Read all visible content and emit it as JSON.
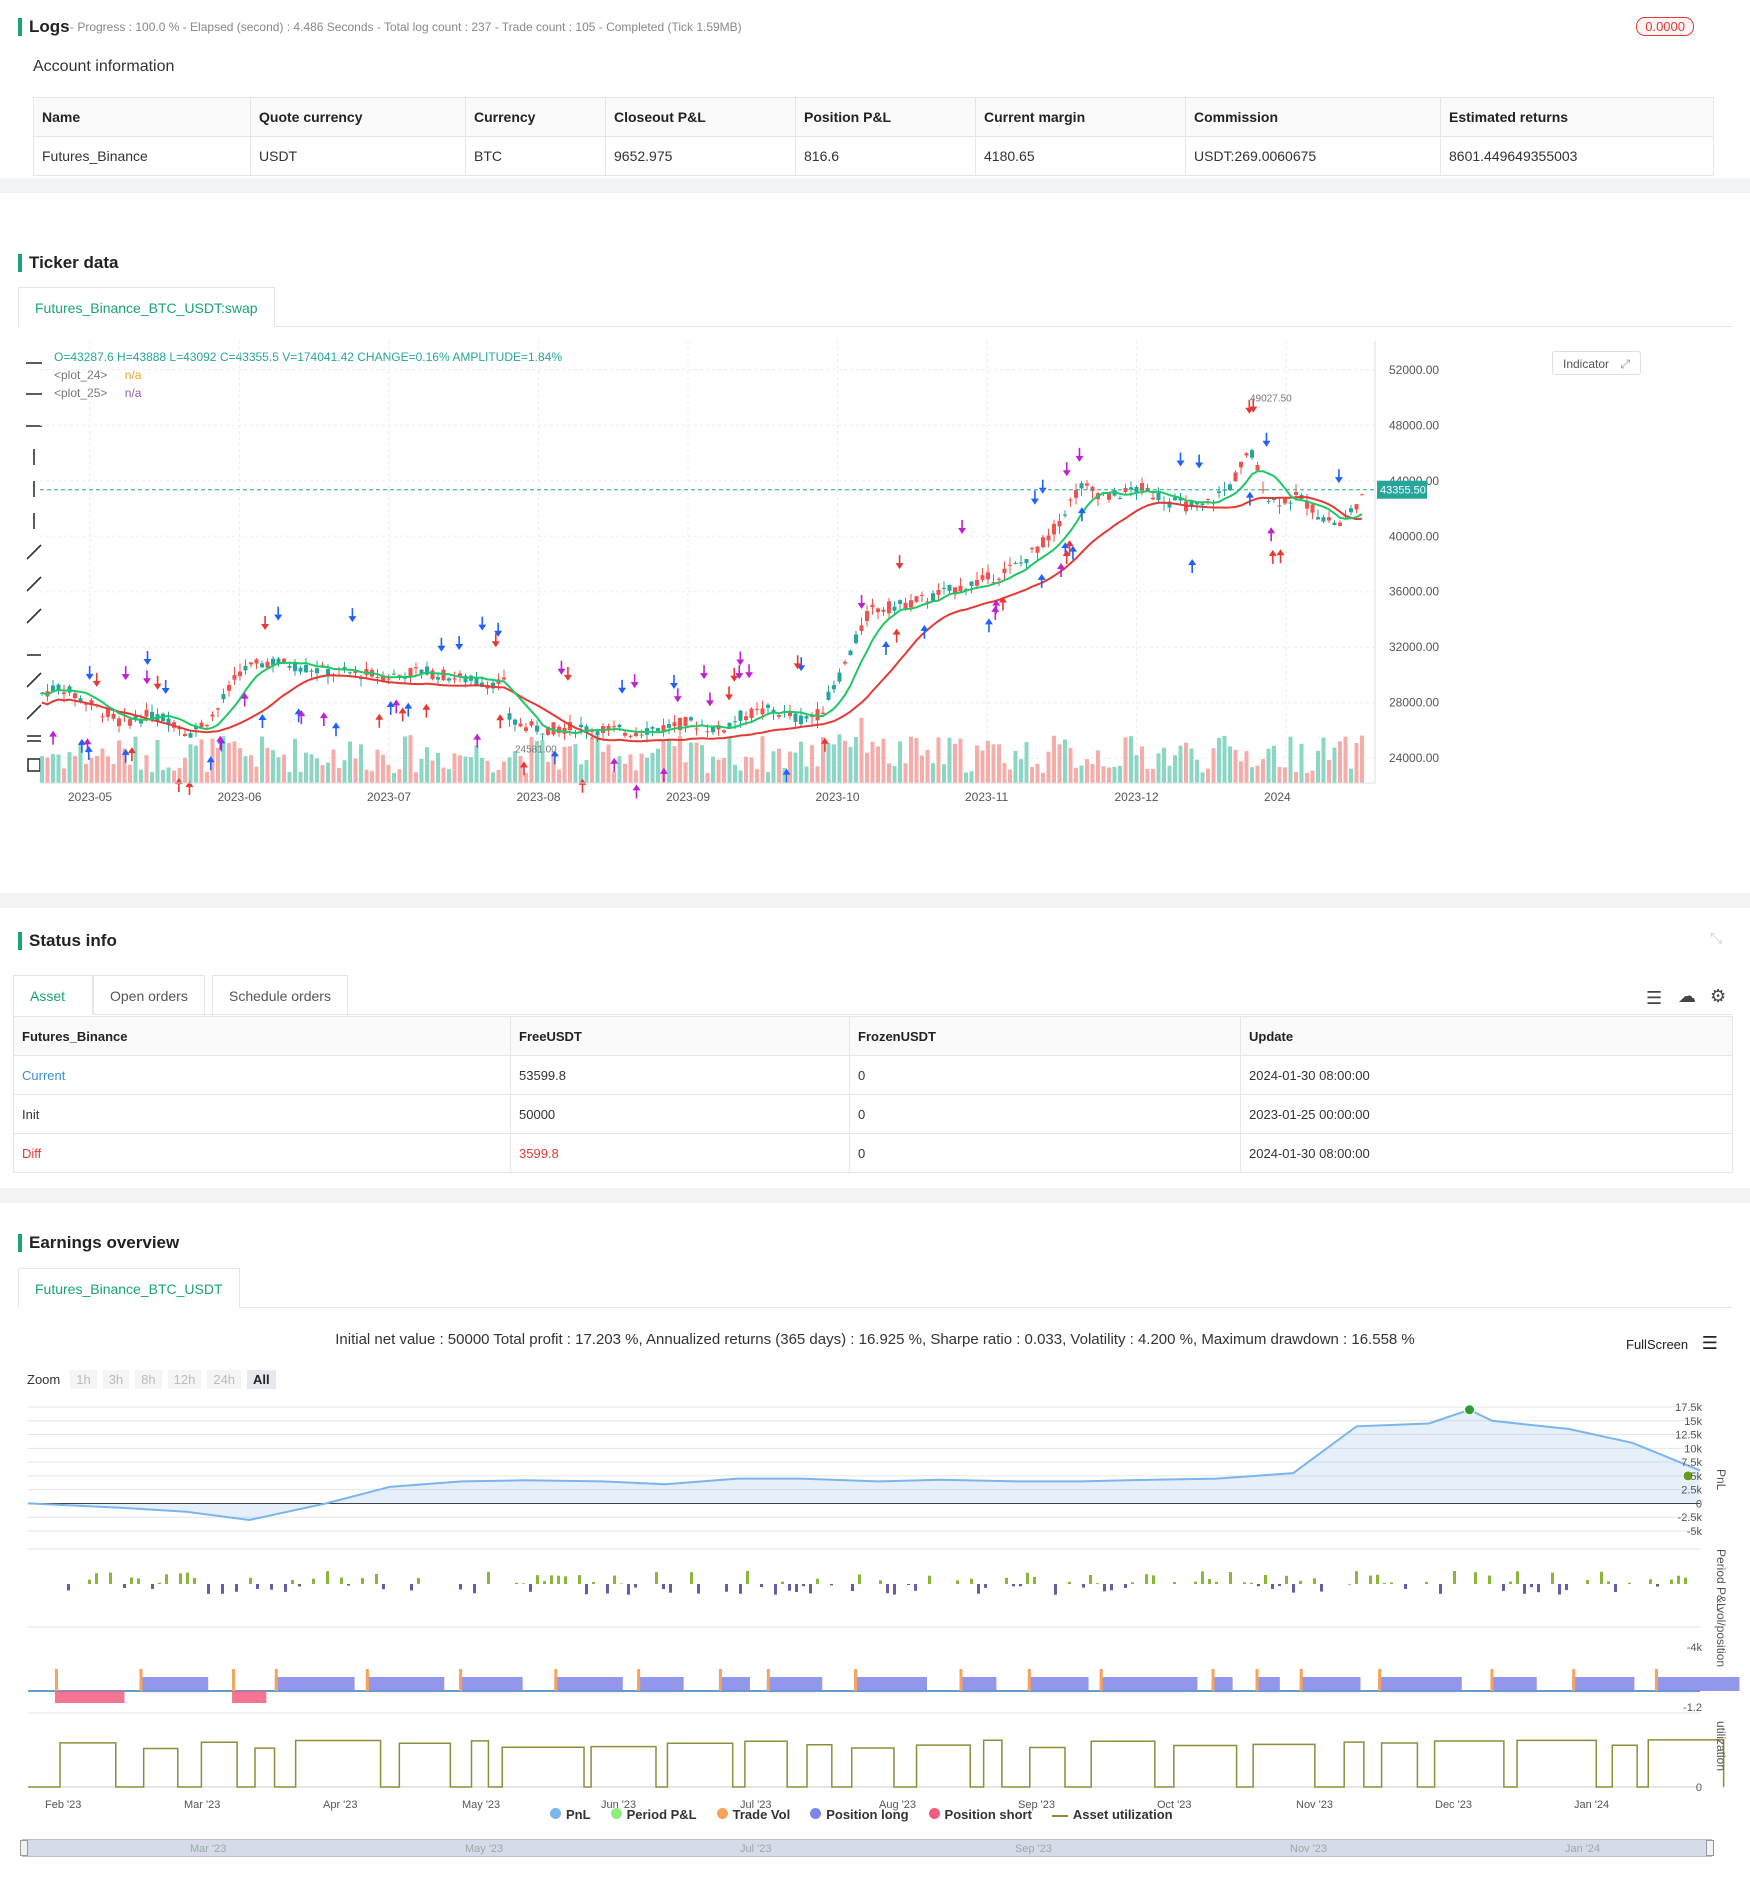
{
  "logs": {
    "title": "Logs",
    "status": "- Progress : 100.0 % - Elapsed (second) : 4.486  Seconds - Total log count : 237 - Trade count : 105 - Completed (Tick 1.59MB)",
    "badge": "0.0000",
    "account_title": "Account information",
    "columns": [
      "Name",
      "Quote currency",
      "Currency",
      "Closeout P&L",
      "Position P&L",
      "Current margin",
      "Commission",
      "Estimated returns"
    ],
    "row": [
      "Futures_Binance",
      "USDT",
      "BTC",
      "9652.975",
      "816.6",
      "4180.65",
      "USDT:269.0060675",
      "8601.449649355003"
    ]
  },
  "ticker": {
    "title": "Ticker data",
    "tab": "Futures_Binance_BTC_USDT:swap",
    "ohlc_line": "O=43287.6 H=43888 L=43092 C=43355.5 V=174041.42 CHANGE=0.16% AMPLITUDE=1.84%",
    "legend": [
      {
        "name": "<plot_24>",
        "value": "n/a",
        "color": "#f0a020"
      },
      {
        "name": "<plot_25>",
        "value": "n/a",
        "color": "#9b59b6"
      }
    ],
    "indicator_button": "Indicator",
    "price_axis": [
      "52000.00",
      "48000.00",
      "44000.00",
      "40000.00",
      "36000.00",
      "32000.00",
      "28000.00",
      "24000.00"
    ],
    "time_axis": [
      "2023-05",
      "2023-06",
      "2023-07",
      "2023-08",
      "2023-09",
      "2023-10",
      "2023-11",
      "2023-12",
      "2024"
    ],
    "last_price": "43355.50",
    "high_label": "49027.50",
    "low_label": "24581.00",
    "colors": {
      "up": "#26a69a",
      "down": "#ef5350",
      "fast_ma": "#1ec864",
      "slow_ma": "#e53935",
      "marker_magenta": "#c020d0",
      "marker_blue": "#2060ff",
      "marker_red": "#e53935"
    }
  },
  "status": {
    "title": "Status info",
    "tabs": [
      "Asset",
      "Open orders",
      "Schedule orders"
    ],
    "columns": [
      "Futures_Binance",
      "FreeUSDT",
      "FrozenUSDT",
      "Update"
    ],
    "rows": [
      [
        "Current",
        "53599.8",
        "0",
        "2024-01-30 08:00:00"
      ],
      [
        "Init",
        "50000",
        "0",
        "2023-01-25 00:00:00"
      ],
      [
        "Diff",
        "3599.8",
        "0",
        "2024-01-30 08:00:00"
      ]
    ]
  },
  "earnings": {
    "title": "Earnings overview",
    "tab": "Futures_Binance_BTC_USDT",
    "summary": "Initial net value : 50000 Total profit : 17.203 %, Annualized returns (365 days) : 16.925 %, Sharpe ratio : 0.033, Volatility : 4.200 %, Maximum drawdown : 16.558 %",
    "fullscreen": "FullScreen",
    "zoom_label": "Zoom",
    "zoom_buttons": [
      "1h",
      "3h",
      "8h",
      "12h",
      "24h",
      "All"
    ],
    "pnl_axis": [
      "17.5k",
      "15k",
      "12.5k",
      "10k",
      "7.5k",
      "5k",
      "2.5k",
      "0",
      "-2.5k",
      "-5k"
    ],
    "pnl_axis_title": "PnL",
    "period_axis": [
      "-4k"
    ],
    "period_axis_title": "Period P&L",
    "vol_axis": [
      "-1.2"
    ],
    "vol_axis_title": "vol/position",
    "util_axis": [
      "0"
    ],
    "util_axis_title": "utilization",
    "time_axis": [
      "Feb '23",
      "Mar '23",
      "Apr '23",
      "May '23",
      "Jun '23",
      "Jul '23",
      "Aug '23",
      "Sep '23",
      "Oct '23",
      "Nov '23",
      "Dec '23",
      "Jan '24"
    ],
    "navigator_axis": [
      "Mar '23",
      "May '23",
      "Jul '23",
      "Sep '23",
      "Nov '23",
      "Jan '24"
    ],
    "legend": [
      {
        "name": "PnL",
        "color": "#7cb5ec"
      },
      {
        "name": "Period P&L",
        "color": "#90ed7d"
      },
      {
        "name": "Trade Vol",
        "color": "#f7a35c"
      },
      {
        "name": "Position long",
        "color": "#8085e9"
      },
      {
        "name": "Position short",
        "color": "#f15c80"
      },
      {
        "name": "Asset utilization",
        "color": "#8d8d3c"
      }
    ],
    "chart_data": {
      "type": "line",
      "ylabel": "PnL",
      "ylim": [
        -5000,
        17500
      ],
      "x": [
        "2023-01-25",
        "2023-02-15",
        "2023-03-01",
        "2023-03-15",
        "2023-04-01",
        "2023-04-15",
        "2023-05-01",
        "2023-05-15",
        "2023-06-01",
        "2023-06-15",
        "2023-07-01",
        "2023-07-15",
        "2023-08-01",
        "2023-08-15",
        "2023-09-01",
        "2023-09-15",
        "2023-10-01",
        "2023-10-15",
        "2023-11-01",
        "2023-11-15",
        "2023-12-01",
        "2023-12-10",
        "2023-12-15",
        "2024-01-01",
        "2024-01-15",
        "2024-01-30"
      ],
      "series": [
        {
          "name": "PnL",
          "values": [
            0,
            -800,
            -1500,
            -3000,
            0,
            3000,
            4000,
            4200,
            4000,
            3500,
            4500,
            4500,
            4000,
            4300,
            4000,
            4000,
            4300,
            4500,
            5500,
            14000,
            14500,
            17000,
            15000,
            13500,
            11000,
            6000
          ]
        }
      ]
    }
  }
}
